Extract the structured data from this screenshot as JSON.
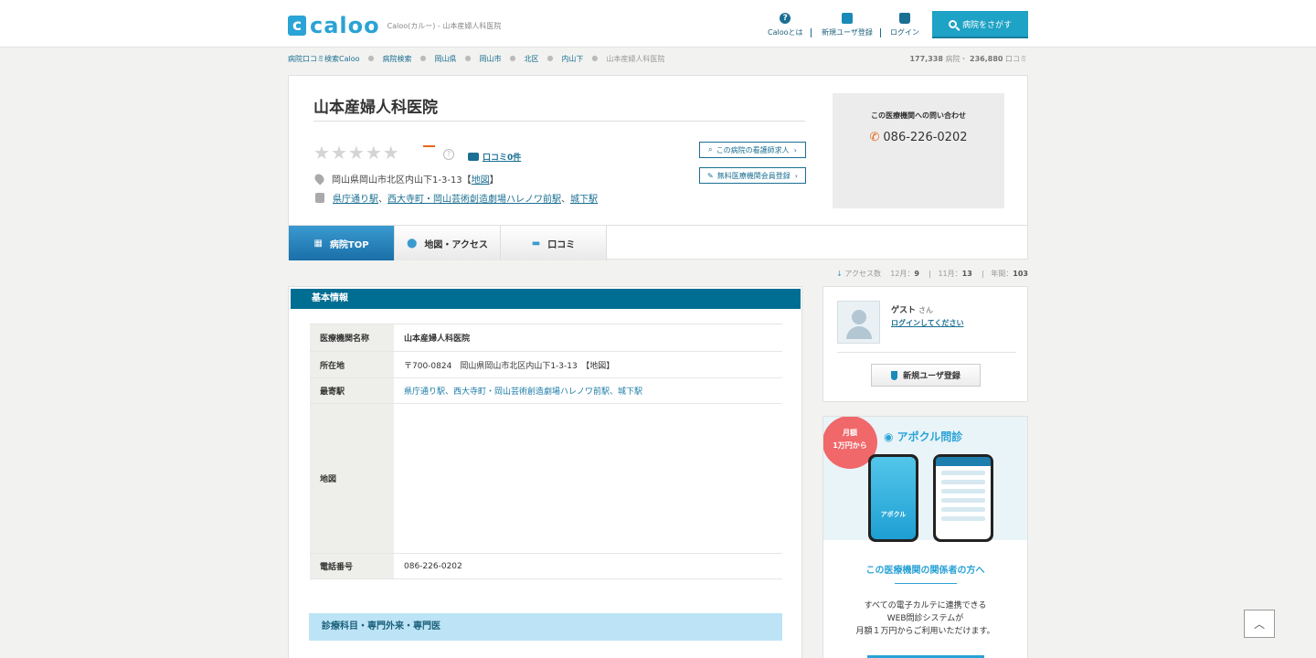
{
  "header": {
    "logo_mark": "c",
    "logo_text": "caloo",
    "logo_sub": "Caloo(カルー) - 山本産婦人科医院",
    "nav": [
      {
        "label": "Calooとは",
        "icon": "question-icon"
      },
      {
        "label": "新規ユーザ登録",
        "icon": "leaf-icon"
      },
      {
        "label": "ログイン",
        "icon": "lock-icon"
      }
    ],
    "search_label": "病院をさがす"
  },
  "breadcrumb": {
    "items": [
      "病院口コミ検索Caloo",
      "病院検索",
      "岡山県",
      "岡山市",
      "北区",
      "内山下"
    ],
    "current": "山本産婦人科医院"
  },
  "counts": {
    "hospitals": "177,338",
    "hospitals_unit": "病院・",
    "reviews": "236,880",
    "reviews_unit": "口コミ"
  },
  "hospital": {
    "name": "山本産婦人科医院",
    "rating": 0,
    "rating_max": 5,
    "help": "?",
    "review_link": "口コミ0件",
    "address": "岡山県岡山市北区内山下1-3-13",
    "map_label": "地図",
    "bracket_open": "【",
    "bracket_close": "】",
    "stations": [
      "県庁通り駅",
      "西大寺町・岡山芸術創造劇場ハレノワ前駅",
      "城下駅"
    ],
    "station_sep": "、",
    "btn_nurse": "この病院の看護師求人",
    "btn_register": "無料医療機関会員登録"
  },
  "contact": {
    "title": "この医療機関への問い合わせ",
    "phone": "086-226-0202"
  },
  "tabs": [
    {
      "label": "病院TOP",
      "icon": "hospital-icon",
      "active": true
    },
    {
      "label": "地図・アクセス",
      "icon": "pin-icon",
      "active": false
    },
    {
      "label": "口コミ",
      "icon": "comment-icon",
      "active": false
    }
  ],
  "access": {
    "label": "アクセス数",
    "dec_label": "12月：",
    "dec": "9",
    "nov_label": "11月：",
    "nov": "13",
    "year_label": "年間：",
    "year": "103"
  },
  "basic": {
    "title": "基本情報",
    "rows": [
      {
        "key": "医療機関名称",
        "value": "山本産婦人科医院"
      },
      {
        "key": "所在地",
        "value": "〒700-0824　岡山県岡山市北区内山下1-3-13　【地図】"
      },
      {
        "key": "最寄駅",
        "value": "県庁通り駅、西大寺町・岡山芸術創造劇場ハレノワ前駅、城下駅"
      },
      {
        "key": "地図",
        "value": ""
      },
      {
        "key": "電話番号",
        "value": "086-226-0202"
      }
    ],
    "sub_title": "診療科目・専門外来・専門医"
  },
  "user": {
    "name": "ゲスト",
    "honorific": "さん",
    "login_link": "ログインしてください",
    "register": "新規ユーザ登録"
  },
  "ad": {
    "badge_1": "月額",
    "badge_2": "1万円から",
    "brand": "アポクル問診",
    "phone_brand": "アポクル",
    "heading": "この医療機関の関係者の方へ",
    "text_1": "すべての電子カルテに連携できる",
    "text_2": "WEB問診システムが",
    "text_3": "月額１万円からご利用いただけます。"
  },
  "colors": {
    "accent": "#1ea2c6",
    "section_header": "#006e92",
    "tab_active": "#1a6fa8",
    "rating_dash": "#e8661a"
  }
}
